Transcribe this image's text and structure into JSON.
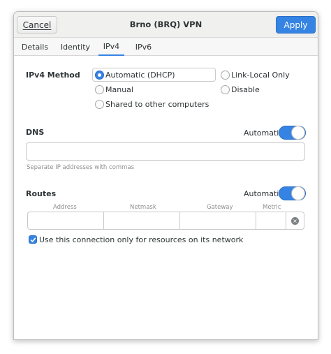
{
  "header": {
    "cancel_label": "Cancel",
    "title": "Brno (BRQ) VPN",
    "apply_label": "Apply"
  },
  "tabs": [
    {
      "label": "Details"
    },
    {
      "label": "Identity"
    },
    {
      "label": "IPv4",
      "active": true
    },
    {
      "label": "IPv6"
    }
  ],
  "ipv4": {
    "method_label": "IPv4 Method",
    "options": [
      {
        "label": "Automatic (DHCP)",
        "selected": true
      },
      {
        "label": "Link-Local Only",
        "selected": false
      },
      {
        "label": "Manual",
        "selected": false
      },
      {
        "label": "Disable",
        "selected": false
      },
      {
        "label": "Shared to other computers",
        "selected": false
      }
    ]
  },
  "dns": {
    "label": "DNS",
    "automatic_label": "Automatic",
    "automatic_on": true,
    "value": "",
    "hint": "Separate IP addresses with commas"
  },
  "routes": {
    "label": "Routes",
    "automatic_label": "Automatic",
    "automatic_on": true,
    "columns": [
      "Address",
      "Netmask",
      "Gateway",
      "Metric"
    ],
    "row": [
      "",
      "",
      "",
      ""
    ]
  },
  "only_resources": {
    "label": "Use this connection only for resources on its network",
    "checked": true
  },
  "colors": {
    "accent": "#3584e4",
    "header_bg": "#f0f0ef"
  },
  "icons": {
    "delete": "clear-icon",
    "check": "check-icon"
  }
}
